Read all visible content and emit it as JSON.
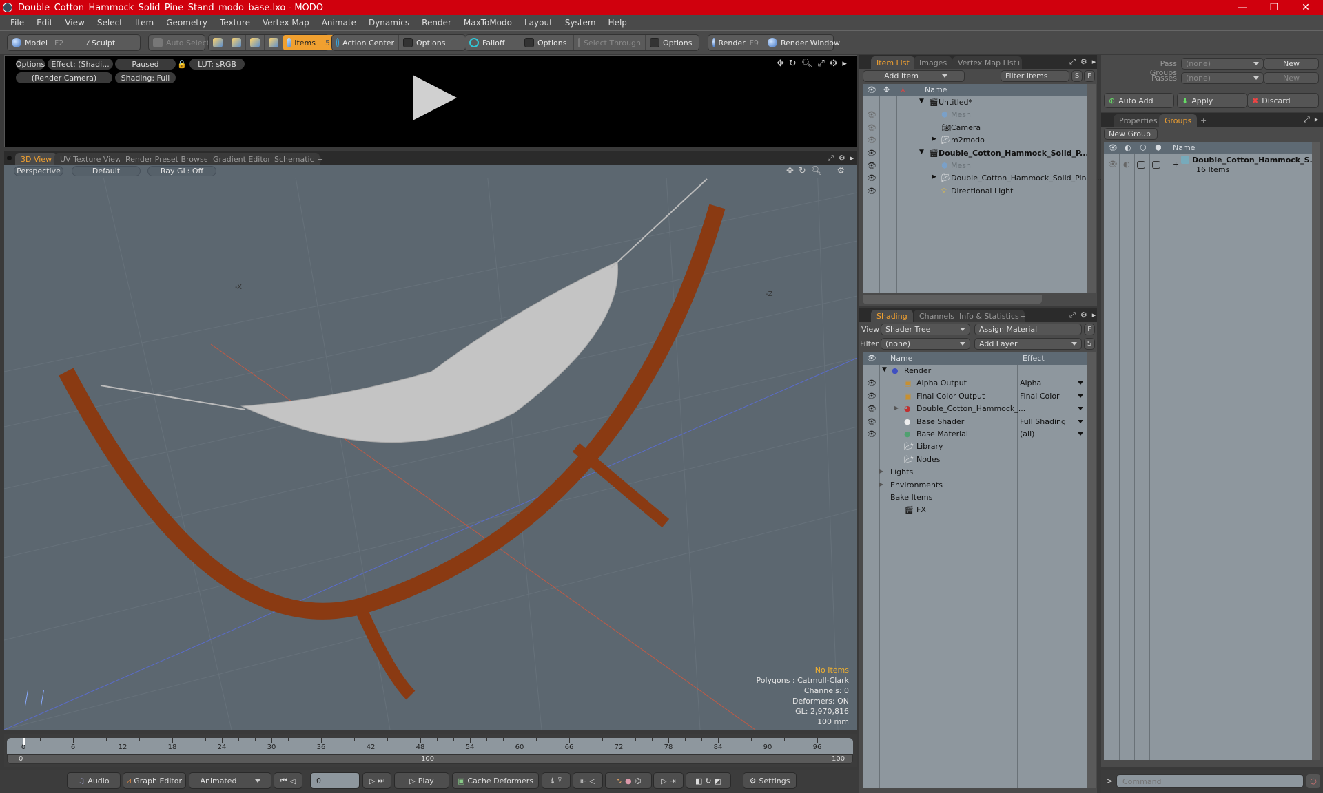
{
  "window": {
    "title": "Double_Cotton_Hammock_Solid_Pine_Stand_modo_base.lxo - MODO",
    "controls": {
      "minimize": "—",
      "restore": "❐",
      "close": "✕"
    }
  },
  "menu": [
    "File",
    "Edit",
    "View",
    "Select",
    "Item",
    "Geometry",
    "Texture",
    "Vertex Map",
    "Animate",
    "Dynamics",
    "Render",
    "MaxToModo",
    "Layout",
    "System",
    "Help"
  ],
  "toolbar": {
    "model": "Model",
    "model_key": "F2",
    "sculpt": "Sculpt",
    "auto_select": "Auto Select",
    "items": "Items",
    "items_key": "5",
    "action_center": "Action Center",
    "options1": "Options",
    "falloff": "Falloff",
    "options2": "Options",
    "select_through": "Select Through",
    "options3": "Options",
    "render": "Render",
    "render_key": "F9",
    "render_window": "Render Window"
  },
  "render_panel": {
    "options": "Options",
    "effect": "Effect: (Shadi...",
    "paused": "Paused",
    "lut": "LUT: sRGB",
    "camera": "(Render Camera)",
    "shading": "Shading: Full"
  },
  "viewport_tabs": [
    "3D View",
    "UV Texture View",
    "Render Preset Browser",
    "Gradient Editor",
    "Schematic"
  ],
  "viewport": {
    "perspective": "Perspective",
    "default": "Default",
    "raygl": "Ray GL: Off",
    "axis_x_label": "-X",
    "axis_z_label": "-Z",
    "stats": {
      "selection": "No Items",
      "polygons": "Polygons : Catmull-Clark",
      "channels": "Channels: 0",
      "deformers": "Deformers: ON",
      "gl": "GL: 2,970,816",
      "scale": "100 mm"
    },
    "colors": {
      "background": "#5c6770",
      "wood": "#8a3a12",
      "cloth": "#c8c8c8"
    }
  },
  "timeline": {
    "ticks": [
      "0",
      "6",
      "12",
      "18",
      "24",
      "30",
      "36",
      "42",
      "48",
      "54",
      "60",
      "66",
      "72",
      "78",
      "84",
      "90",
      "96"
    ],
    "range_start": "0",
    "range_end": "100",
    "current": "0",
    "max": 100
  },
  "bottombar": {
    "audio": "Audio",
    "graph_editor": "Graph Editor",
    "animated": "Animated",
    "frame": "0",
    "play": "Play",
    "cache_deformers": "Cache Deformers",
    "settings": "Settings"
  },
  "item_list": {
    "tabs": [
      "Item List",
      "Images",
      "Vertex Map List"
    ],
    "add_item": "Add Item",
    "filter": "Filter Items",
    "s": "S",
    "f": "F",
    "col_name": "Name",
    "rows": [
      {
        "label": "Untitled*",
        "indent": 0,
        "icon": "scene-icon",
        "bold": false,
        "dim": false,
        "eye": ""
      },
      {
        "label": "Mesh",
        "indent": 1,
        "icon": "mesh-icon",
        "bold": false,
        "dim": true,
        "eye": "dim"
      },
      {
        "label": "Camera",
        "indent": 1,
        "icon": "camera-icon",
        "bold": false,
        "dim": false,
        "eye": "dim"
      },
      {
        "label": "m2modo",
        "indent": 1,
        "icon": "folder-icon",
        "bold": false,
        "dim": false,
        "eye": "dim"
      },
      {
        "label": "Double_Cotton_Hammock_Solid_P...",
        "indent": 0,
        "icon": "scene-icon",
        "bold": true,
        "dim": false,
        "eye": "on"
      },
      {
        "label": "Mesh",
        "indent": 1,
        "icon": "mesh-icon",
        "bold": false,
        "dim": true,
        "eye": "on"
      },
      {
        "label": "Double_Cotton_Hammock_Solid_Pine_...",
        "indent": 1,
        "icon": "folder-icon",
        "bold": false,
        "dim": false,
        "eye": "on"
      },
      {
        "label": "Directional Light",
        "indent": 1,
        "icon": "light-icon",
        "bold": false,
        "dim": false,
        "eye": "on"
      }
    ]
  },
  "shading": {
    "tabs": [
      "Shading",
      "Channels",
      "Info & Statistics"
    ],
    "view_label": "View",
    "view_value": "Shader Tree",
    "assign_material": "Assign Material",
    "filter_label": "Filter",
    "filter_value": "(none)",
    "add_layer": "Add Layer",
    "f": "F",
    "s": "S",
    "col_name": "Name",
    "col_effect": "Effect",
    "rows": [
      {
        "label": "Render",
        "effect": "",
        "indent": 0,
        "eye": false,
        "icon": "render-sphere-icon",
        "dropdown": false
      },
      {
        "label": "Alpha Output",
        "effect": "Alpha",
        "indent": 1,
        "eye": true,
        "icon": "output-icon",
        "dropdown": true
      },
      {
        "label": "Final Color Output",
        "effect": "Final Color",
        "indent": 1,
        "eye": true,
        "icon": "output-icon",
        "dropdown": true
      },
      {
        "label": "Double_Cotton_Hammock_...",
        "effect": "",
        "indent": 1,
        "eye": true,
        "icon": "material-group-icon",
        "dropdown": true
      },
      {
        "label": "Base Shader",
        "effect": "Full Shading",
        "indent": 1,
        "eye": true,
        "icon": "shader-icon",
        "dropdown": true
      },
      {
        "label": "Base Material",
        "effect": "(all)",
        "indent": 1,
        "eye": true,
        "icon": "material-icon",
        "dropdown": true
      },
      {
        "label": "Library",
        "effect": "",
        "indent": 1,
        "eye": false,
        "icon": "folder-icon",
        "dropdown": false
      },
      {
        "label": "Nodes",
        "effect": "",
        "indent": 1,
        "eye": false,
        "icon": "folder-icon",
        "dropdown": false
      },
      {
        "label": "Lights",
        "effect": "",
        "indent": 0,
        "eye": false,
        "icon": "",
        "dropdown": false
      },
      {
        "label": "Environments",
        "effect": "",
        "indent": 0,
        "eye": false,
        "icon": "",
        "dropdown": false
      },
      {
        "label": "Bake Items",
        "effect": "",
        "indent": 0,
        "eye": false,
        "icon": "",
        "dropdown": false
      },
      {
        "label": "FX",
        "effect": "",
        "indent": 1,
        "eye": false,
        "icon": "scene-icon",
        "dropdown": false
      }
    ]
  },
  "passes": {
    "pass_groups_label": "Pass Groups",
    "pass_groups_value": "(none)",
    "new1": "New",
    "passes_label": "Passes",
    "passes_value": "(none)",
    "new2": "New",
    "auto_add": "Auto Add",
    "apply": "Apply",
    "discard": "Discard"
  },
  "groups": {
    "tabs": [
      "Properties",
      "Groups"
    ],
    "new_group": "New Group",
    "col_name": "Name",
    "group_name": "Double_Cotton_Hammock_S...",
    "group_count": "16 Items"
  },
  "command": {
    "prompt": ">",
    "placeholder": "Command"
  }
}
